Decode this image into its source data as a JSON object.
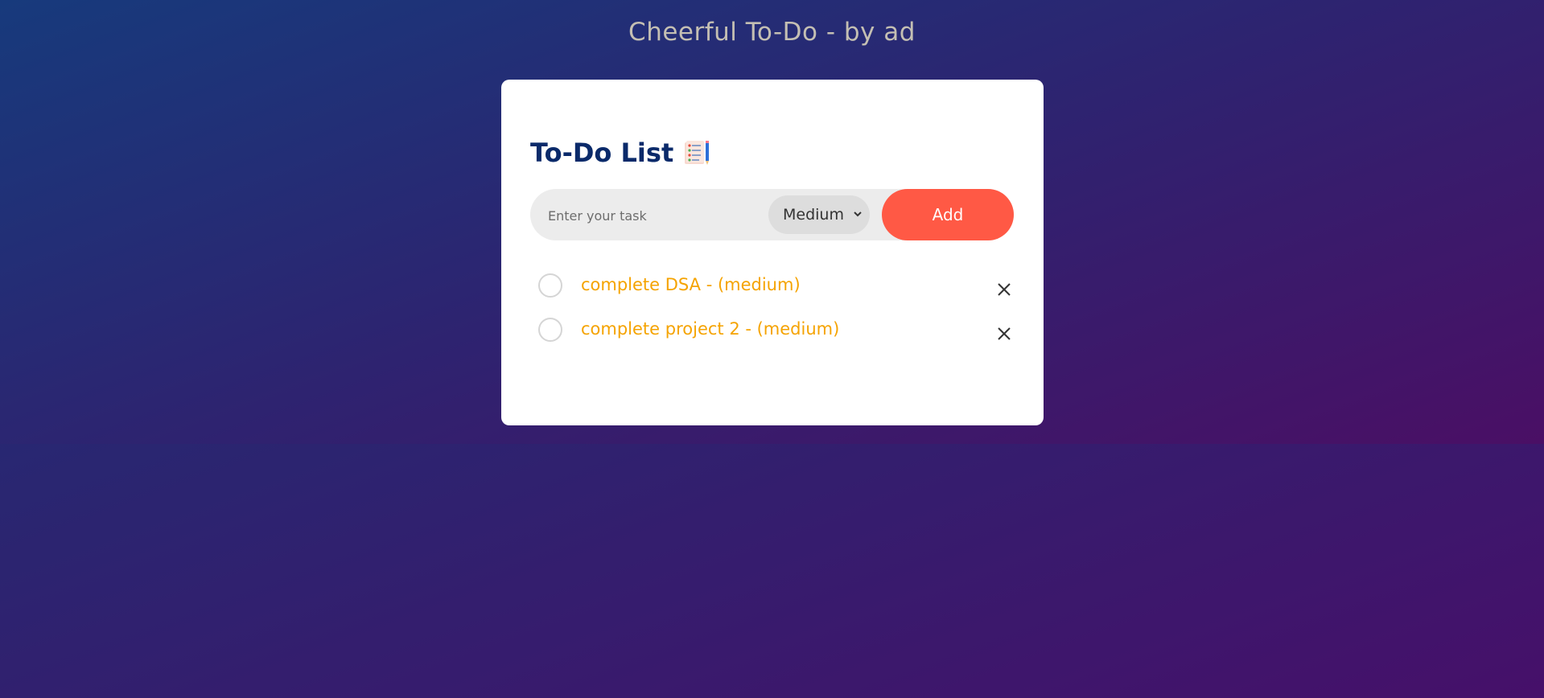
{
  "app": {
    "title": "Cheerful To-Do - by ad"
  },
  "card": {
    "heading": "To-Do List",
    "heading_icon": "notepad-icon"
  },
  "form": {
    "input_placeholder": "Enter your task",
    "input_value": "",
    "priority_selected": "Medium",
    "add_label": "Add"
  },
  "tasks": [
    {
      "label": "complete DSA - (medium)",
      "done": false
    },
    {
      "label": "complete project 2 - (medium)",
      "done": false
    }
  ],
  "colors": {
    "accent": "#ff5945",
    "task_text": "#f5a300",
    "heading": "#0a2a6a"
  },
  "icons": {
    "delete": "close-icon",
    "select_caret": "chevron-down-icon"
  }
}
